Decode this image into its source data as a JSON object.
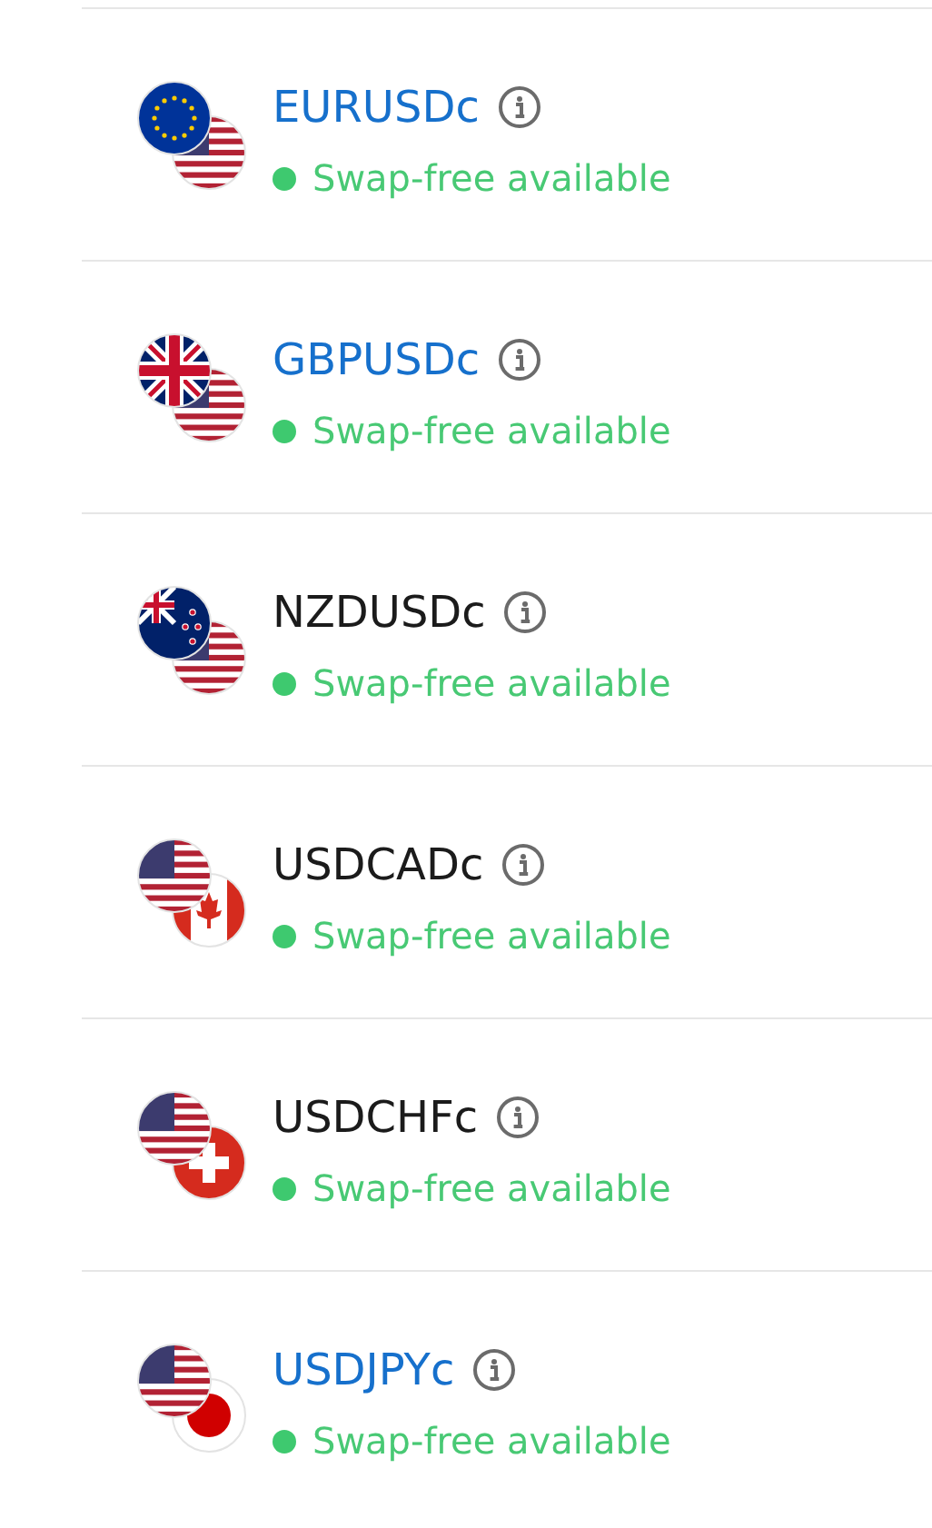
{
  "instruments": [
    {
      "symbol": "EURUSDc",
      "link": true,
      "flags": [
        {
          "kind": "eu"
        },
        {
          "kind": "us"
        }
      ],
      "status": "Swap-free available"
    },
    {
      "symbol": "GBPUSDc",
      "link": true,
      "flags": [
        {
          "kind": "gb"
        },
        {
          "kind": "us"
        }
      ],
      "status": "Swap-free available"
    },
    {
      "symbol": "NZDUSDc",
      "link": false,
      "flags": [
        {
          "kind": "nz"
        },
        {
          "kind": "us"
        }
      ],
      "status": "Swap-free available"
    },
    {
      "symbol": "USDCADc",
      "link": false,
      "flags": [
        {
          "kind": "us"
        },
        {
          "kind": "ca"
        }
      ],
      "status": "Swap-free available"
    },
    {
      "symbol": "USDCHFc",
      "link": false,
      "flags": [
        {
          "kind": "us"
        },
        {
          "kind": "ch"
        }
      ],
      "status": "Swap-free available"
    },
    {
      "symbol": "USDJPYc",
      "link": true,
      "flags": [
        {
          "kind": "us"
        },
        {
          "kind": "jp"
        }
      ],
      "status": "Swap-free available"
    }
  ]
}
